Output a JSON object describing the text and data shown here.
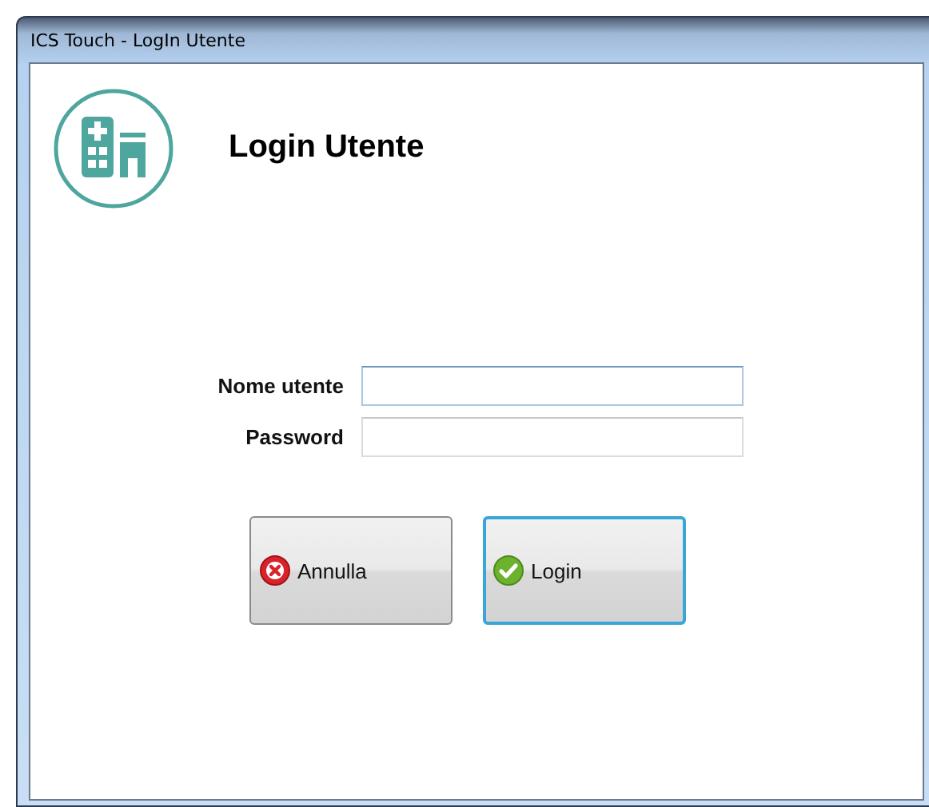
{
  "window": {
    "title": "ICS Touch - LogIn Utente"
  },
  "heading": "Login Utente",
  "fields": [
    {
      "label": "Nome utente",
      "focused": true
    },
    {
      "label": "Password",
      "focused": false
    }
  ],
  "buttons": [
    {
      "label": "Annulla",
      "kind": "cancel",
      "default": false
    },
    {
      "label": "Login",
      "kind": "ok",
      "default": true
    }
  ]
}
